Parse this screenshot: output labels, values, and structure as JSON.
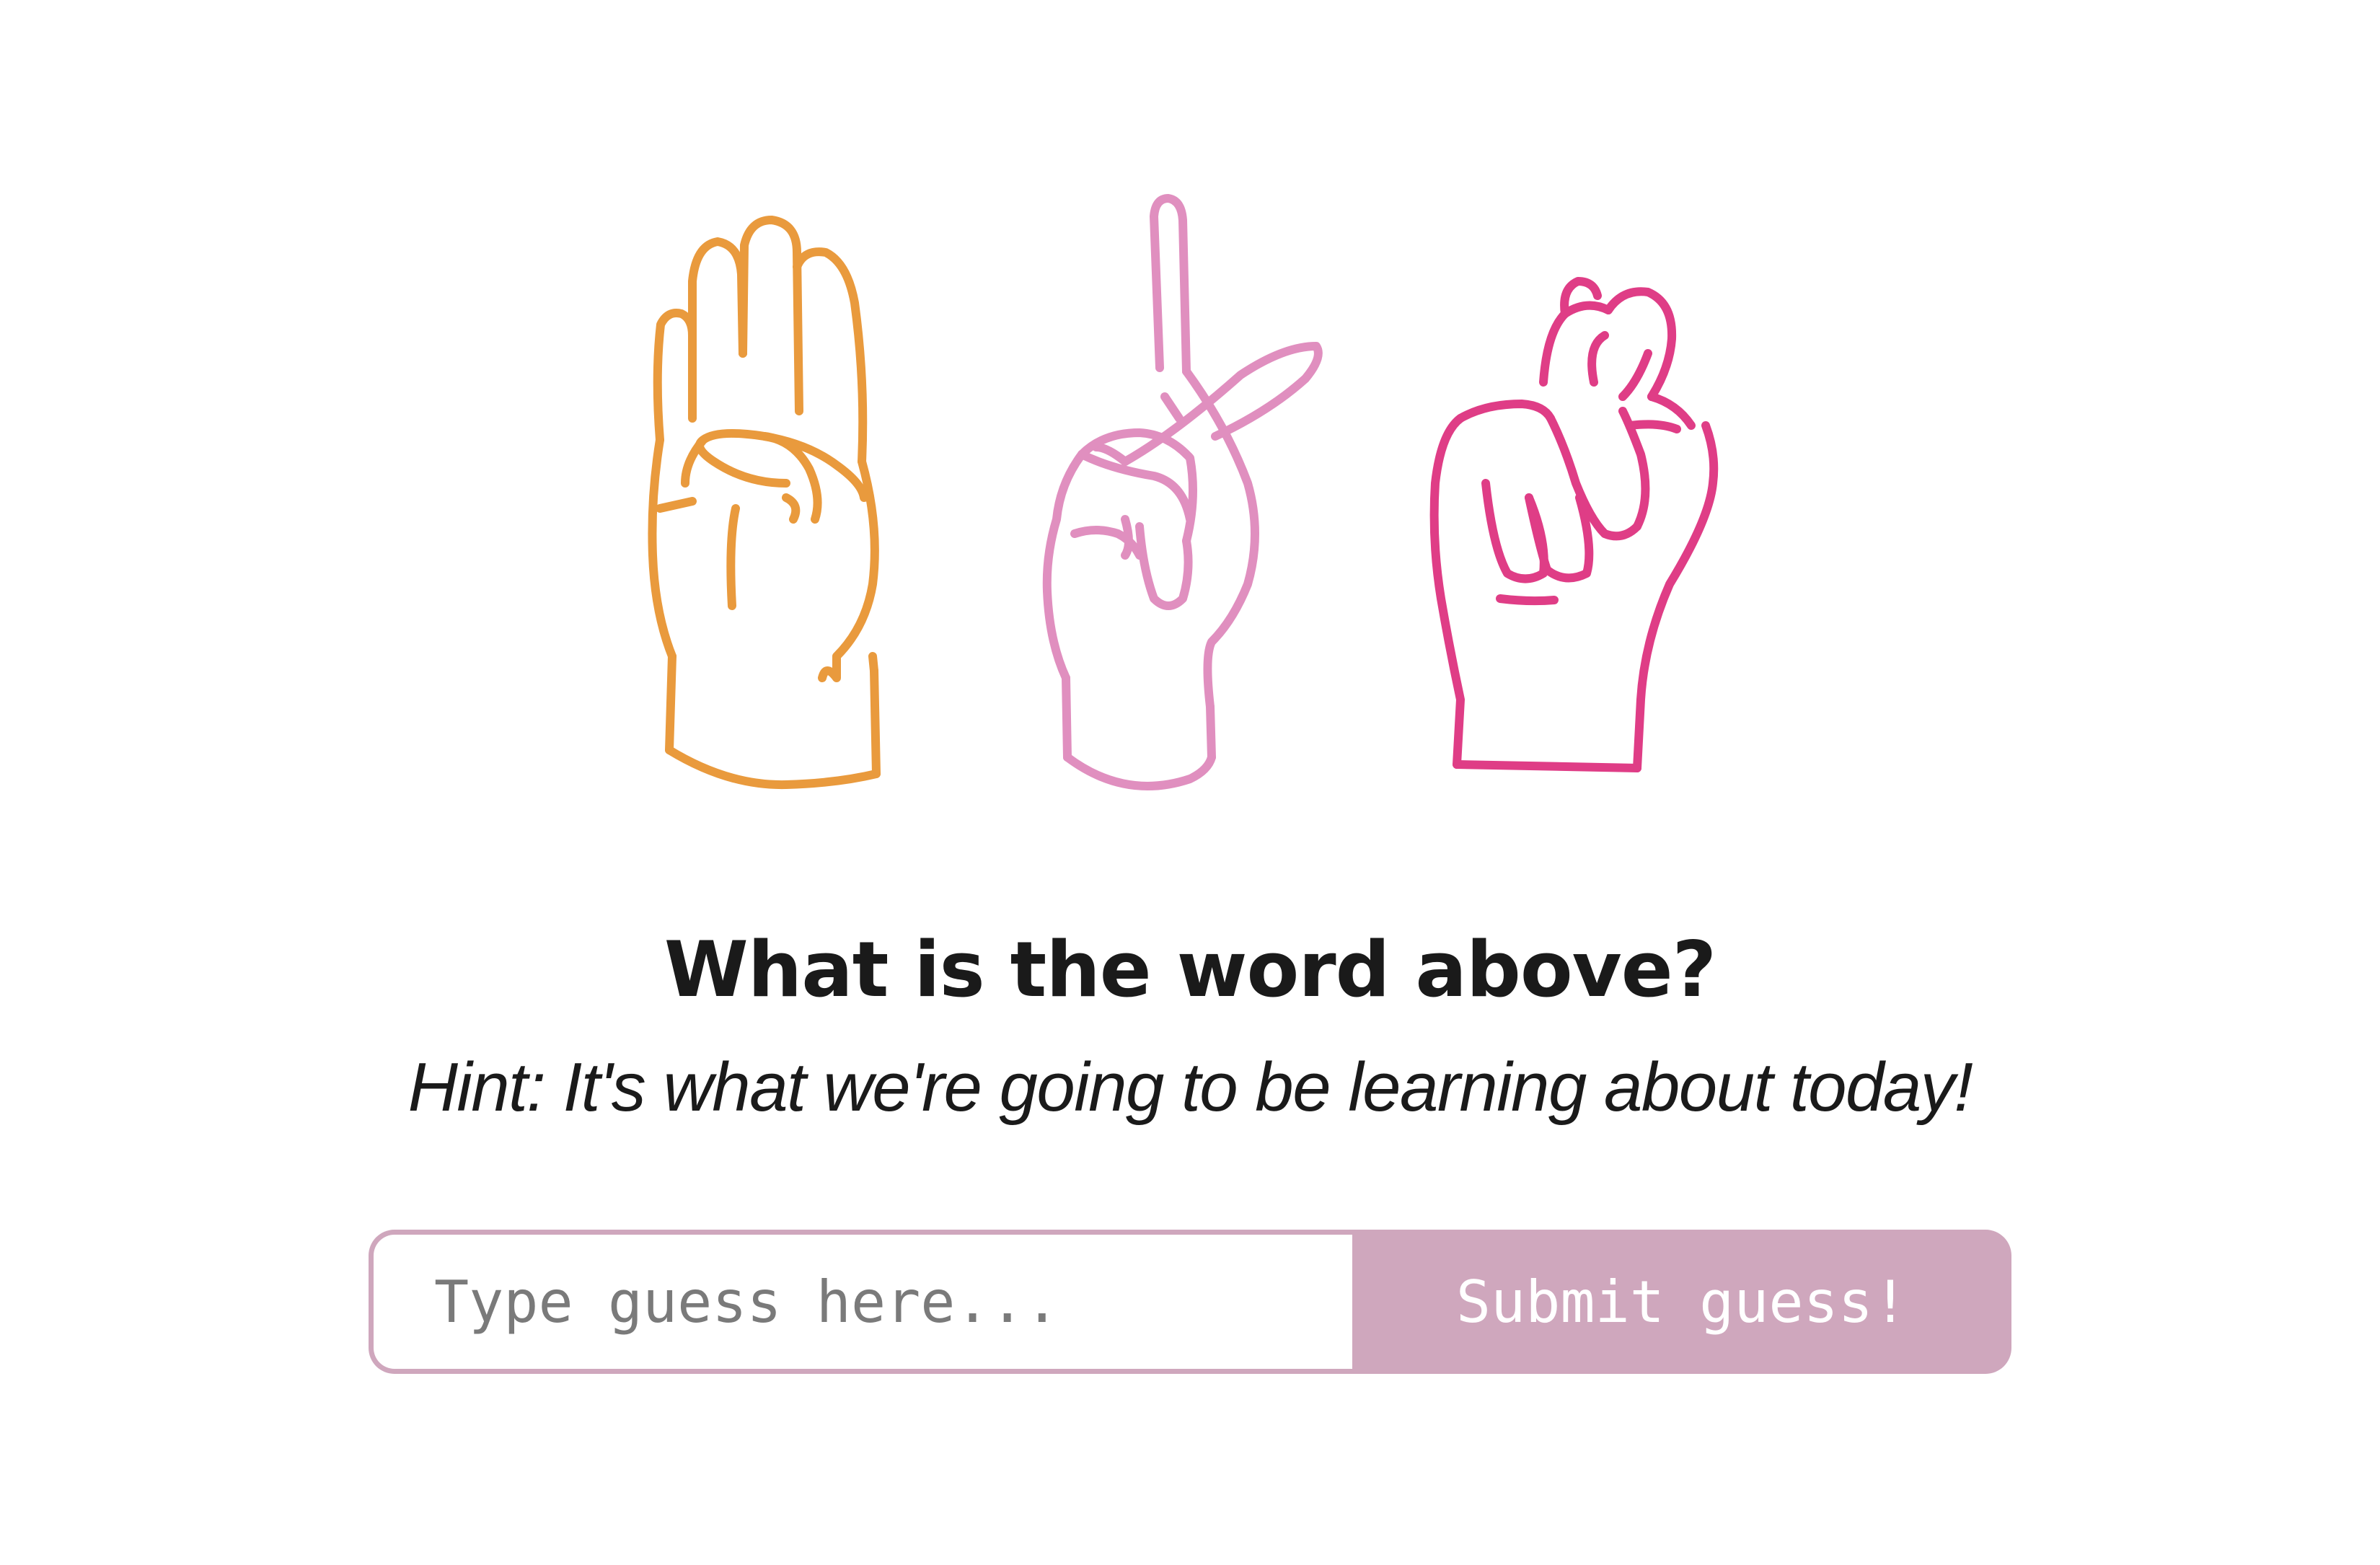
{
  "hands": [
    {
      "icon": "open-hand-four-fingers-icon",
      "color": "#e99a3d"
    },
    {
      "icon": "index-finger-pointing-up-icon",
      "color": "#e08fbf"
    },
    {
      "icon": "closed-fist-icon",
      "color": "#df3d86"
    }
  ],
  "quiz": {
    "title": "What is the word above?",
    "hint": "Hint: It's what we're going to be learning about today!"
  },
  "form": {
    "placeholder": "Type guess here...",
    "value": "",
    "submit_label": "Submit guess!"
  },
  "colors": {
    "accent": "#cfa7bd",
    "text": "#1a1a1a"
  }
}
